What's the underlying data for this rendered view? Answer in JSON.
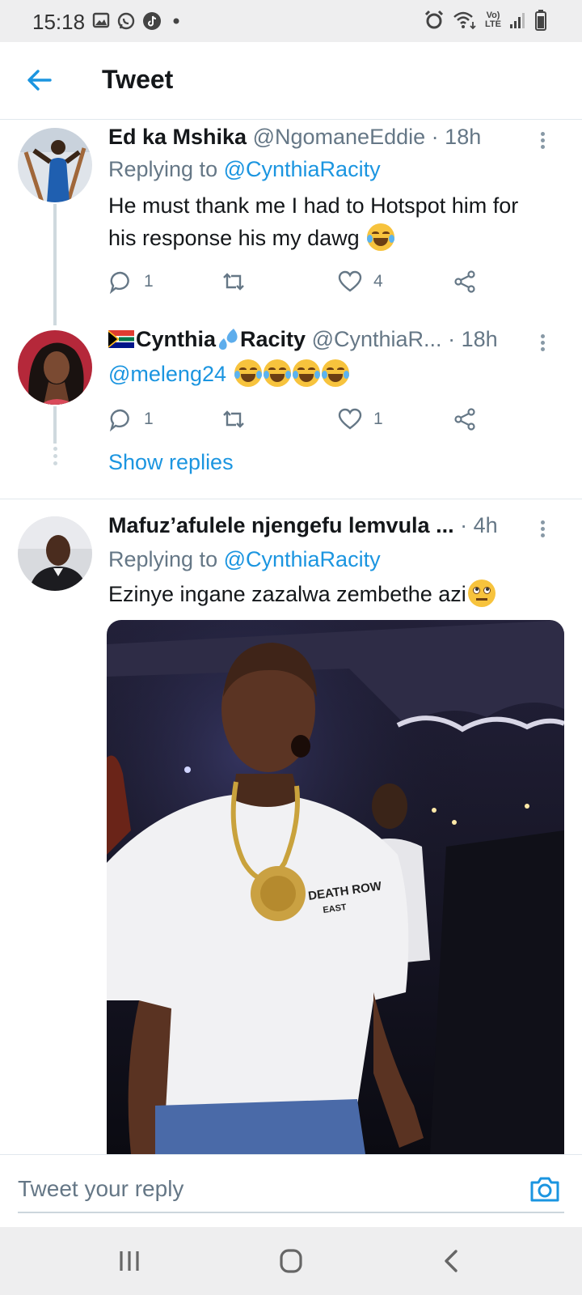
{
  "status_bar": {
    "time": "15:18",
    "network_top": "Vo)",
    "network_bottom": "LTE",
    "left_icons": [
      "gallery-icon",
      "whatsapp-icon",
      "tiktok-icon",
      "dot-icon"
    ],
    "right_icons": [
      "alarm-icon",
      "wifi-icon",
      "signal-icon",
      "battery-icon"
    ]
  },
  "header": {
    "back_icon": "arrow-left-icon",
    "title": "Tweet"
  },
  "tweets": [
    {
      "name": "Ed ka Mshika",
      "handle": "@NgomaneEddie",
      "separator": "·",
      "time": "18h",
      "replying_prefix": "Replying to ",
      "replying_to": "@CynthiaRacity",
      "text": "He must thank me I had to Hotspot him for his response his my dawg",
      "emoji": "face-with-tears-of-joy",
      "replies": "1",
      "retweets": "",
      "likes": "4"
    },
    {
      "name_part1": "Cynthia",
      "name_part2": "Racity",
      "handle": "@CynthiaR...",
      "separator": "·",
      "time": "18h",
      "text": "@meleng24",
      "emoji_count": 4,
      "replies": "1",
      "retweets": "",
      "likes": "1",
      "show_replies": "Show replies"
    },
    {
      "name": "Mafuz’afulele njengefu lemvula ...",
      "separator": "·",
      "time": "4h",
      "replying_prefix": "Replying to ",
      "replying_to": "@CynthiaRacity",
      "text": "Ezinye ingane zazalwa zembethe azi",
      "emoji": "face-with-rolling-eyes",
      "photo_shirt_text_1": "DEATH ROW",
      "photo_shirt_text_2": "EAST"
    }
  ],
  "reply_bar": {
    "placeholder": "Tweet your reply",
    "camera_icon": "camera-icon"
  },
  "colors": {
    "accent": "#1b95e0",
    "secondary_text": "#657786",
    "divider": "#e1e8ed",
    "system_bar": "#eeeeef"
  }
}
